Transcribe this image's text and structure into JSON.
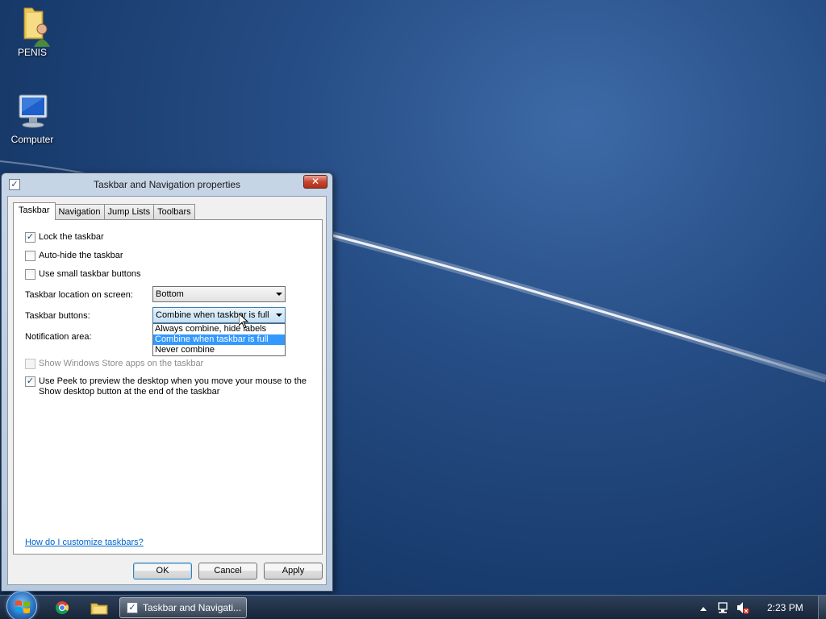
{
  "desktop": {
    "icons": [
      {
        "label": "PENIS",
        "icon": "user-folder-icon"
      },
      {
        "label": "Computer",
        "icon": "computer-icon"
      }
    ]
  },
  "dialog": {
    "title": "Taskbar and Navigation properties",
    "close_label": "✕",
    "tabs": [
      {
        "label": "Taskbar",
        "active": true
      },
      {
        "label": "Navigation",
        "active": false
      },
      {
        "label": "Jump Lists",
        "active": false
      },
      {
        "label": "Toolbars",
        "active": false
      }
    ],
    "checkboxes": {
      "lock": {
        "label": "Lock the taskbar",
        "checked": true
      },
      "autohide": {
        "label": "Auto-hide the taskbar",
        "checked": false
      },
      "small": {
        "label": "Use small taskbar buttons",
        "checked": false
      },
      "store_apps": {
        "label": "Show Windows Store apps on the taskbar",
        "checked": false,
        "disabled": true
      },
      "peek": {
        "label": "Use Peek to preview the desktop when you move your mouse to the Show desktop button at the end of the taskbar",
        "checked": true
      }
    },
    "location_label": "Taskbar location on screen:",
    "location_value": "Bottom",
    "buttons_label": "Taskbar buttons:",
    "buttons_value": "Combine when taskbar is full",
    "notification_label": "Notification area:",
    "dropdown_options": [
      {
        "label": "Always combine, hide labels",
        "selected": false
      },
      {
        "label": "Combine when taskbar is full",
        "selected": true
      },
      {
        "label": "Never combine",
        "selected": false
      }
    ],
    "help_link": "How do I customize taskbars?",
    "ok_label": "OK",
    "cancel_label": "Cancel",
    "apply_label": "Apply"
  },
  "taskbar": {
    "task_label": "Taskbar and Navigati...",
    "clock": "2:23 PM",
    "pinned": [
      "chrome-icon",
      "explorer-folder-icon"
    ]
  }
}
